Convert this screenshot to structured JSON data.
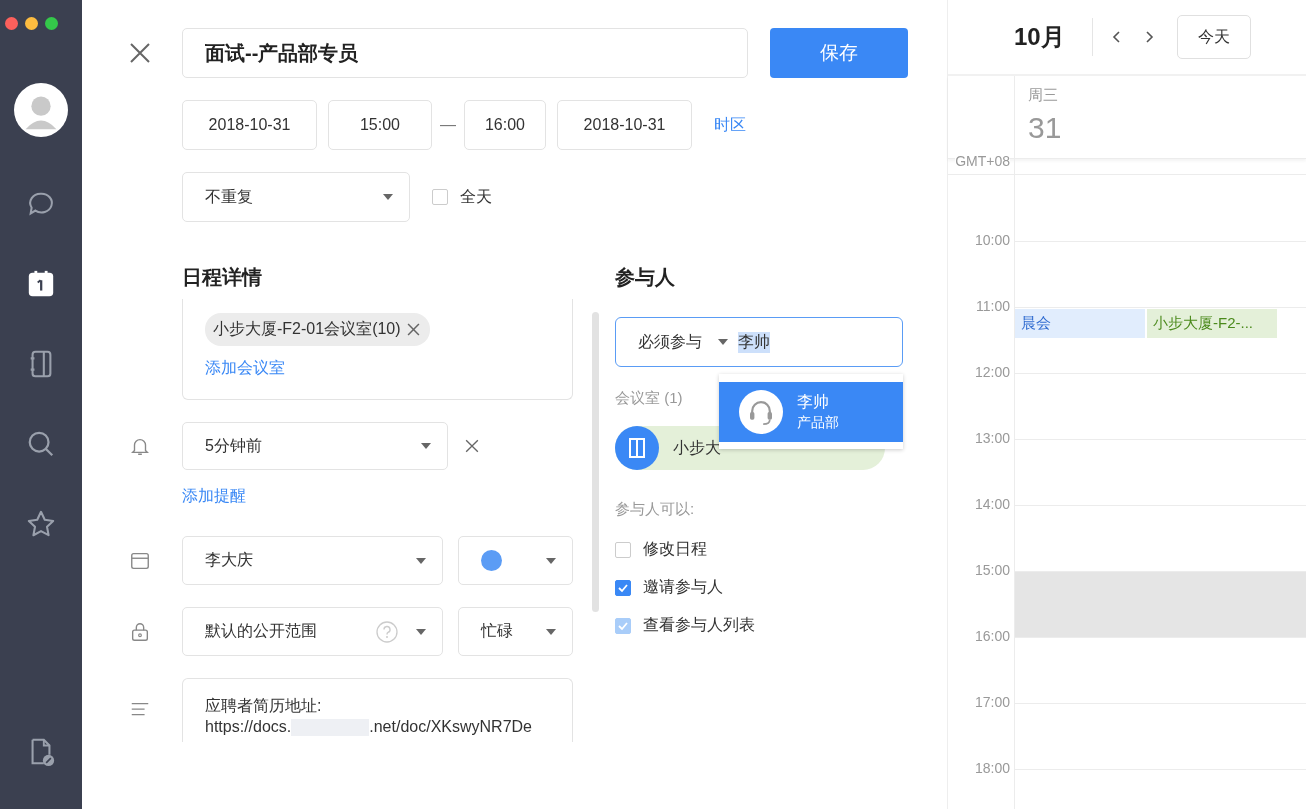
{
  "form": {
    "title": "面试--产品部专员",
    "save": "保存",
    "start_date": "2018-10-31",
    "start_time": "15:00",
    "dash": "—",
    "end_time": "16:00",
    "end_date": "2018-10-31",
    "timezone": "时区",
    "repeat": "不重复",
    "all_day": {
      "label": "全天",
      "checked": false
    }
  },
  "details": {
    "heading": "日程详情",
    "room_chip": "小步大厦-F2-01会议室(10)",
    "add_room": "添加会议室",
    "reminder": "5分钟前",
    "add_reminder": "添加提醒",
    "calendar": "李大庆",
    "visibility": "默认的公开范围",
    "availability": "忙碌",
    "description": {
      "first_line": "应聘者简历地址:",
      "url_start": "https://docs.",
      "url_end": ".net/doc/XKswyNR7De"
    }
  },
  "participants": {
    "heading": "参与人",
    "role": "必须参与",
    "typed": "李帅",
    "suggestions": [
      {
        "name": "李帅",
        "dept": "产品部",
        "selected": true
      }
    ],
    "rooms_label": "会议室 (1)",
    "room_chip": "小步大",
    "permissions_label": "参与人可以:",
    "permissions": [
      {
        "label": "修改日程",
        "checked": false,
        "disabled": false
      },
      {
        "label": "邀请参与人",
        "checked": true,
        "disabled": false
      },
      {
        "label": "查看参与人列表",
        "checked": true,
        "disabled": true
      }
    ]
  },
  "calendar": {
    "month": "10月",
    "today": "今天",
    "weekday": "周三",
    "day": "31",
    "timezone": "GMT+08",
    "hours": [
      {
        "time": "10:00",
        "highlighted": false
      },
      {
        "time": "11:00",
        "highlighted": false,
        "events": [
          {
            "title": "晨会",
            "color": "#2f6bd0"
          },
          {
            "title": "小步大厦-F2-...",
            "color": "#4b8a1c"
          }
        ]
      },
      {
        "time": "12:00",
        "highlighted": false
      },
      {
        "time": "13:00",
        "highlighted": false
      },
      {
        "time": "14:00",
        "highlighted": false
      },
      {
        "time": "15:00",
        "highlighted": true
      },
      {
        "time": "16:00",
        "highlighted": false
      },
      {
        "time": "17:00",
        "highlighted": false
      },
      {
        "time": "18:00",
        "highlighted": false
      }
    ]
  }
}
